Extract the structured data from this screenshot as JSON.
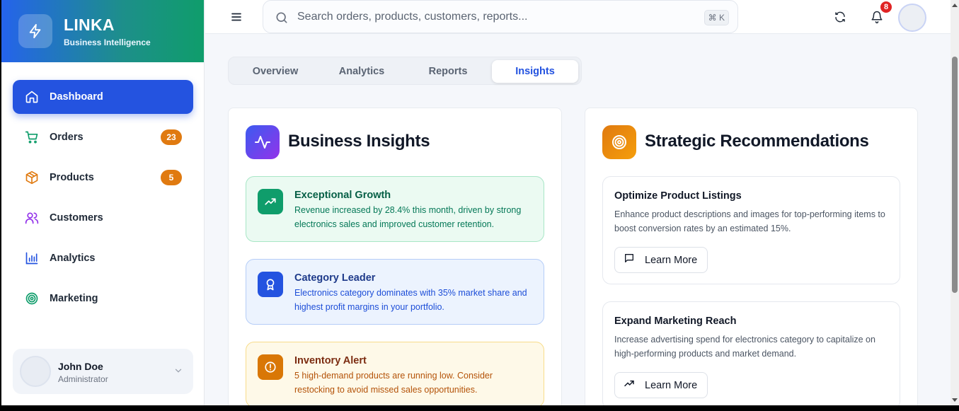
{
  "brand": {
    "title": "LINKA",
    "subtitle": "Business Intelligence"
  },
  "sidebar": {
    "items": [
      {
        "label": "Dashboard",
        "icon": "home-icon",
        "active": true
      },
      {
        "label": "Orders",
        "icon": "cart-icon",
        "badge": "23"
      },
      {
        "label": "Products",
        "icon": "box-icon",
        "badge": "5"
      },
      {
        "label": "Customers",
        "icon": "users-icon"
      },
      {
        "label": "Analytics",
        "icon": "bar-chart-icon"
      },
      {
        "label": "Marketing",
        "icon": "target-icon"
      }
    ],
    "user": {
      "name": "John Doe",
      "role": "Administrator"
    }
  },
  "topbar": {
    "search_placeholder": "Search orders, products, customers, reports...",
    "shortcut": "⌘ K",
    "notifications_count": "8"
  },
  "tabs": [
    {
      "label": "Overview"
    },
    {
      "label": "Analytics"
    },
    {
      "label": "Reports"
    },
    {
      "label": "Insights",
      "active": true
    }
  ],
  "insights": {
    "title": "Business Insights",
    "items": [
      {
        "title": "Exceptional Growth",
        "text": "Revenue increased by 28.4% this month, driven by strong electronics sales and improved customer retention.",
        "icon": "trending-up-icon",
        "accent": "#0f9d6b"
      },
      {
        "title": "Category Leader",
        "text": "Electronics category dominates with 35% market share and highest profit margins in your portfolio.",
        "icon": "award-icon",
        "accent": "#2453e0"
      },
      {
        "title": "Inventory Alert",
        "text": "5 high-demand products are running low. Consider restocking to avoid missed sales opportunities.",
        "icon": "alert-circle-icon",
        "accent": "#d97706"
      }
    ]
  },
  "recommendations": {
    "title": "Strategic Recommendations",
    "items": [
      {
        "title": "Optimize Product Listings",
        "text": "Enhance product descriptions and images for top-performing items to boost conversion rates by an estimated 15%.",
        "button": "Learn More",
        "button_icon": "message-icon"
      },
      {
        "title": "Expand Marketing Reach",
        "text": "Increase advertising spend for electronics category to capitalize on high-performing products and market demand.",
        "button": "Learn More",
        "button_icon": "trending-up-icon"
      }
    ]
  }
}
